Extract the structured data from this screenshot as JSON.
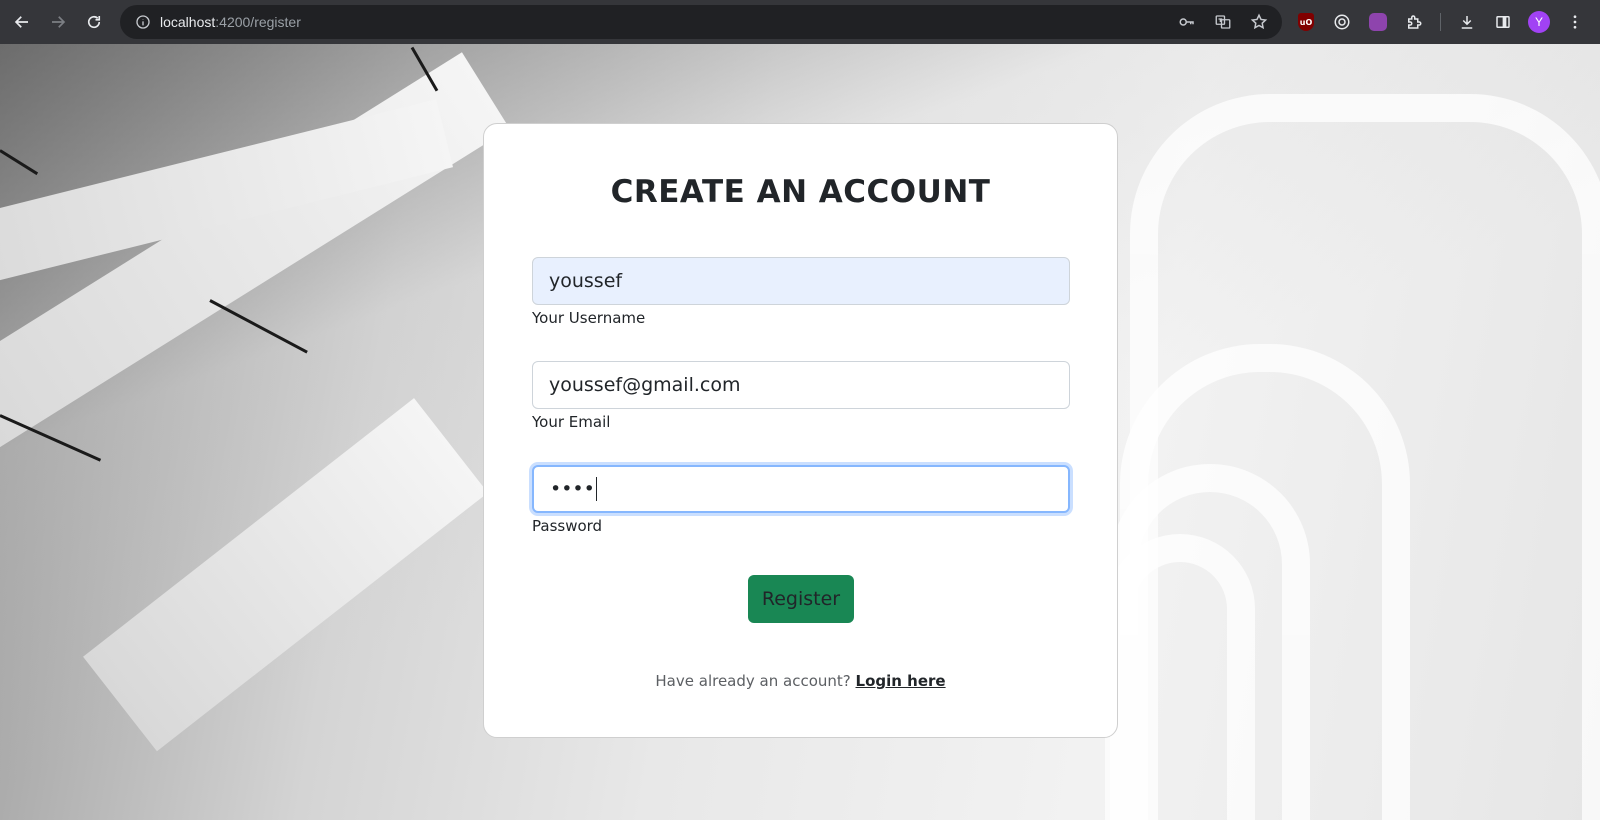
{
  "browser": {
    "url_host": "localhost",
    "url_rest": ":4200/register",
    "profile_initial": "Y",
    "icons": {
      "back": "back-arrow-icon",
      "forward": "forward-arrow-icon",
      "reload": "reload-icon",
      "site_info": "site-info-icon",
      "password": "key-icon",
      "translate": "translate-icon",
      "bookmark": "star-icon",
      "extensions": "puzzle-icon",
      "downloads": "download-icon",
      "side_panel": "side-panel-icon",
      "menu": "kebab-menu-icon"
    }
  },
  "form": {
    "title": "CREATE AN ACCOUNT",
    "username": {
      "value": "youssef",
      "label": "Your Username"
    },
    "email": {
      "value": "youssef@gmail.com",
      "label": "Your Email"
    },
    "password": {
      "value": "••••",
      "label": "Password"
    },
    "submit_label": "Register",
    "login_prompt": "Have already an account?",
    "login_link": "Login here"
  },
  "colors": {
    "register_button": "#198754",
    "autofill_background": "#e8f0fe",
    "focus_ring": "#86b7fe"
  }
}
